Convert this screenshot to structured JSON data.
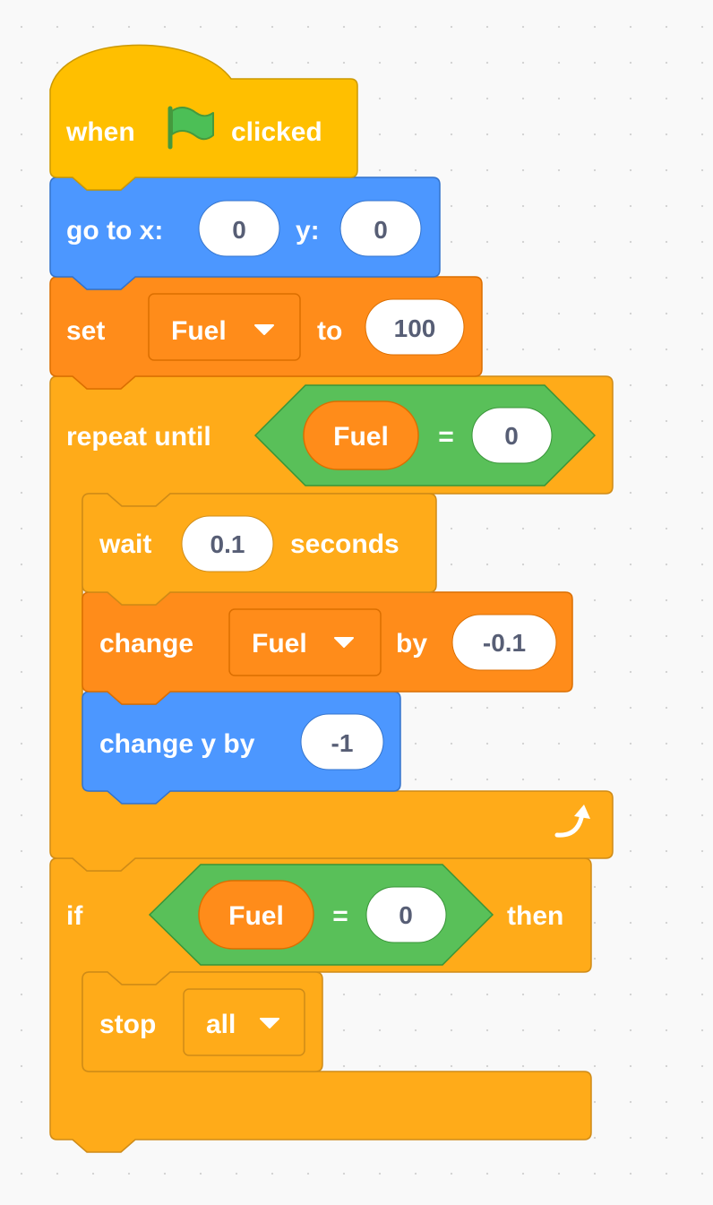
{
  "colors": {
    "events": "#ffbf00",
    "events_stroke": "#cc9900",
    "motion": "#4c97ff",
    "motion_stroke": "#3373cc",
    "variables": "#ff8c1a",
    "variables_stroke": "#db6e00",
    "control": "#ffab19",
    "control_stroke": "#cf8b17",
    "operators": "#59c059",
    "operators_stroke": "#389438",
    "flag": "#4cbf56",
    "canvas": "#f9f9f9"
  },
  "script": {
    "hat": {
      "when": "when",
      "flag_icon": "green-flag-icon",
      "clicked": "clicked"
    },
    "go_to": {
      "label": "go to x:",
      "x_value": "0",
      "y_label": "y:",
      "y_value": "0"
    },
    "set_var": {
      "label": "set",
      "variable": "Fuel",
      "to_label": "to",
      "value": "100"
    },
    "repeat_until": {
      "label": "repeat until",
      "condition": {
        "left": "Fuel",
        "operator": "=",
        "right": "0"
      },
      "loop_icon": "loop-arrow-icon"
    },
    "wait": {
      "label": "wait",
      "value": "0.1",
      "unit": "seconds"
    },
    "change_var": {
      "label": "change",
      "variable": "Fuel",
      "by_label": "by",
      "value": "-0.1"
    },
    "change_y": {
      "label": "change y by",
      "value": "-1"
    },
    "if_block": {
      "label": "if",
      "condition": {
        "left": "Fuel",
        "operator": "=",
        "right": "0"
      },
      "then_label": "then"
    },
    "stop": {
      "label": "stop",
      "option": "all"
    }
  }
}
